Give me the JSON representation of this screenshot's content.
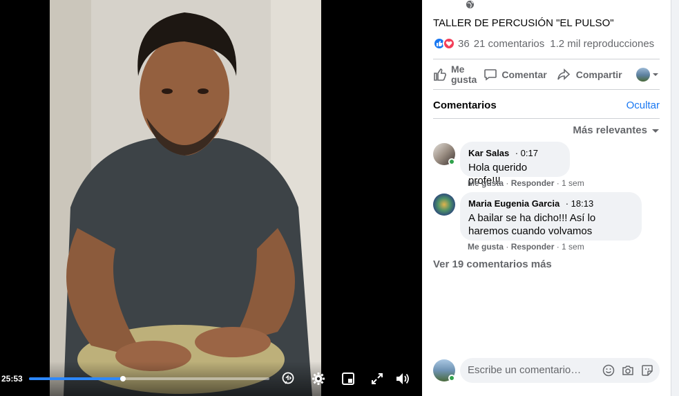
{
  "video": {
    "time": "25:53",
    "progress": 0.39
  },
  "post": {
    "title": "TALLER DE PERCUSIÓN \"EL PULSO\"",
    "reaction_count": "36",
    "comments_count": "21 comentarios",
    "views": "1.2 mil reproducciones"
  },
  "actions": {
    "like_line1": "Me",
    "like_line2": "gusta",
    "comment": "Comentar",
    "share": "Compartir"
  },
  "comments": {
    "header": "Comentarios",
    "hide": "Ocultar",
    "sort": "Más relevantes",
    "items": [
      {
        "name": "Kar Salas",
        "timestamp": "0:17",
        "text": "Hola querido profe!!!",
        "like": "Me gusta",
        "reply": "Responder",
        "age": "1 sem"
      },
      {
        "name": "Maria Eugenia Garcia",
        "timestamp": "18:13",
        "text_line1": "A bailar se ha dicho!!! Así lo",
        "text_line2": "haremos cuando volvamos",
        "like": "Me gusta",
        "reply": "Responder",
        "age": "1 sem"
      }
    ],
    "more": "Ver 19 comentarios más",
    "composer_placeholder": "Escribe un comentario…"
  },
  "colors": {
    "accent": "#1877f2",
    "progress": "#2d88ff",
    "online": "#31a24c"
  }
}
